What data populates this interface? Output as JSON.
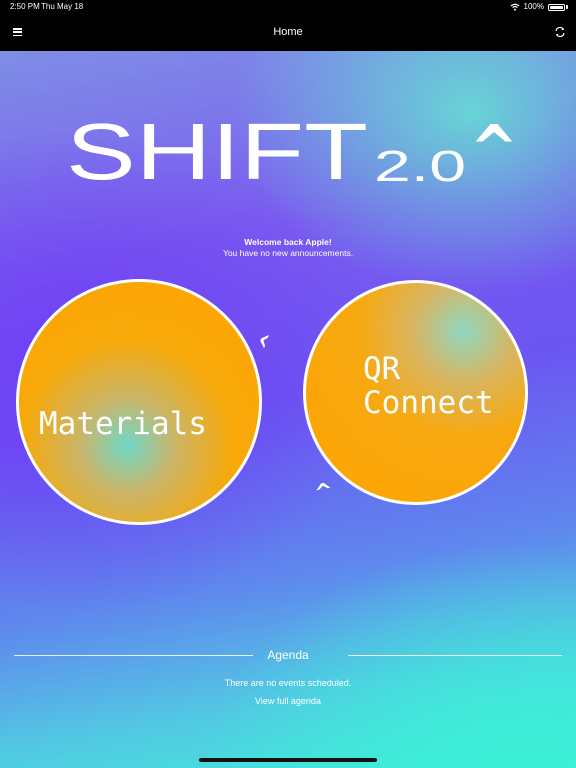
{
  "status_bar": {
    "time": "2:50 PM",
    "date": "Thu May 18",
    "battery": "100%",
    "icons": [
      "wifi-icon",
      "battery-icon"
    ]
  },
  "nav": {
    "title": "Home",
    "left_icon": "menu-icon",
    "right_icon": "refresh-icon"
  },
  "logo": {
    "main": "SHIFT",
    "version": "2.0",
    "mark": "^"
  },
  "welcome": {
    "greeting": "Welcome back Apple!",
    "announcements": "You have no new announcements."
  },
  "tiles": {
    "materials": {
      "label": "Materials"
    },
    "qr_connect": {
      "line1": "QR",
      "line2": "Connect"
    },
    "caret": "^"
  },
  "agenda": {
    "title": "Agenda",
    "empty_text": "There are no events scheduled.",
    "link": "View full agenda"
  },
  "colors": {
    "tile_orange": "#ffa300",
    "gradient_purple": "#6c55f2",
    "gradient_teal": "#3ff0d8"
  }
}
